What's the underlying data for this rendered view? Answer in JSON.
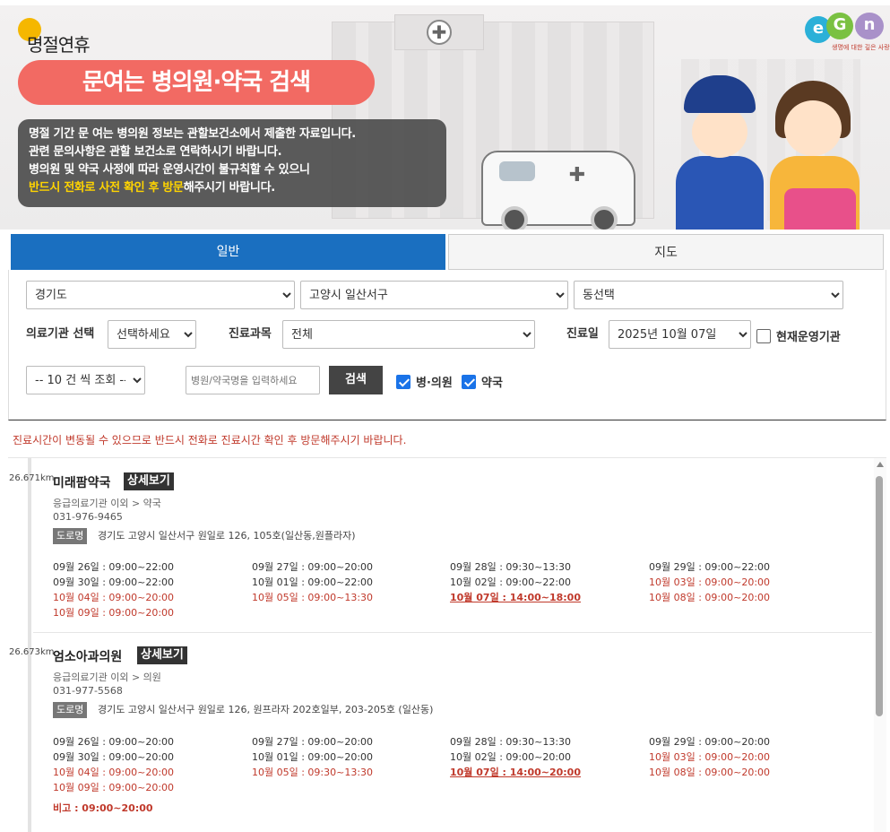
{
  "banner": {
    "holiday_label": "명절연휴",
    "title": "문여는 병의원·약국 검색",
    "notice_lines": [
      "명절 기간 문 여는 병의원 정보는 관할보건소에서 제출한 자료입니다.",
      "관련 문의사항은 관할 보건소로 연락하시기 바랍니다.",
      "병의원 및 약국 사정에 따라 운영시간이 불규칙할 수 있으니"
    ],
    "notice_highlight": "반드시 전화로 사전 확인 후 방문",
    "notice_tail": "해주시기 바랍니다.",
    "logo_letters": [
      "e",
      "G",
      "n"
    ],
    "logo_tagline": "생명에 대한 깊은 사랑"
  },
  "tabs": [
    {
      "label": "일반",
      "active": true
    },
    {
      "label": "지도",
      "active": false
    }
  ],
  "filters": {
    "province": "경기도",
    "city": "고양시 일산서구",
    "dong": "동선택",
    "institution_label": "의료기관 선택",
    "institution_value": "선택하세요",
    "department_label": "진료과목",
    "department_value": "전체",
    "date_label": "진료일",
    "date_value": "2025년 10월 07일",
    "open_now_label": "현재운영기관",
    "open_now_checked": false,
    "page_size": "-- 10 건 씩 조회 --",
    "search_placeholder": "병원/약국명을 입력하세요",
    "search_button": "검색",
    "hospital_label": "병·의원",
    "hospital_checked": true,
    "pharmacy_label": "약국",
    "pharmacy_checked": true
  },
  "warning": "진료시간이 변동될 수 있으므로 반드시 전화로 진료시간 확인 후 방문해주시기 바랍니다.",
  "detail_label": "상세보기",
  "road_label": "도로명",
  "results": [
    {
      "distance": "26.671km",
      "name": "미래팜약국",
      "category": "응급의료기관 이외 > 약국",
      "phone": "031-976-9465",
      "address": "경기도 고양시 일산서구 원일로 126, 105호(일산동,원플라자)",
      "hours": [
        {
          "text": "09월 26일 : 09:00~22:00",
          "style": "normal"
        },
        {
          "text": "09월 27일 : 09:00~20:00",
          "style": "normal"
        },
        {
          "text": "09월 28일 : 09:30~13:30",
          "style": "normal"
        },
        {
          "text": "09월 29일 : 09:00~22:00",
          "style": "normal"
        },
        {
          "text": "09월 30일 : 09:00~22:00",
          "style": "normal"
        },
        {
          "text": "10월 01일 : 09:00~22:00",
          "style": "normal"
        },
        {
          "text": "10월 02일 : 09:00~22:00",
          "style": "normal"
        },
        {
          "text": "10월 03일 : 09:00~20:00",
          "style": "red"
        },
        {
          "text": "10월 04일 : 09:00~20:00",
          "style": "red"
        },
        {
          "text": "10월 05일 : 09:00~13:30",
          "style": "red"
        },
        {
          "text": "10월 07일 : 14:00~18:00",
          "style": "today"
        },
        {
          "text": "10월 08일 : 09:00~20:00",
          "style": "red"
        },
        {
          "text": "10월 09일 : 09:00~20:00",
          "style": "red"
        }
      ],
      "note": ""
    },
    {
      "distance": "26.673km",
      "name": "엄소아과의원",
      "category": "응급의료기관 이외 > 의원",
      "phone": "031-977-5568",
      "address": "경기도 고양시 일산서구 원일로 126, 원프라자 202호일부, 203-205호 (일산동)",
      "hours": [
        {
          "text": "09월 26일 : 09:00~20:00",
          "style": "normal"
        },
        {
          "text": "09월 27일 : 09:00~20:00",
          "style": "normal"
        },
        {
          "text": "09월 28일 : 09:30~13:30",
          "style": "normal"
        },
        {
          "text": "09월 29일 : 09:00~20:00",
          "style": "normal"
        },
        {
          "text": "09월 30일 : 09:00~20:00",
          "style": "normal"
        },
        {
          "text": "10월 01일 : 09:00~20:00",
          "style": "normal"
        },
        {
          "text": "10월 02일 : 09:00~20:00",
          "style": "normal"
        },
        {
          "text": "10월 03일 : 09:00~20:00",
          "style": "red"
        },
        {
          "text": "10월 04일 : 09:00~20:00",
          "style": "red"
        },
        {
          "text": "10월 05일 : 09:30~13:30",
          "style": "red"
        },
        {
          "text": "10월 07일 : 14:00~20:00",
          "style": "today"
        },
        {
          "text": "10월 08일 : 09:00~20:00",
          "style": "red"
        },
        {
          "text": "10월 09일 : 09:00~20:00",
          "style": "red"
        }
      ],
      "note": "비고 : 09:00~20:00"
    }
  ]
}
